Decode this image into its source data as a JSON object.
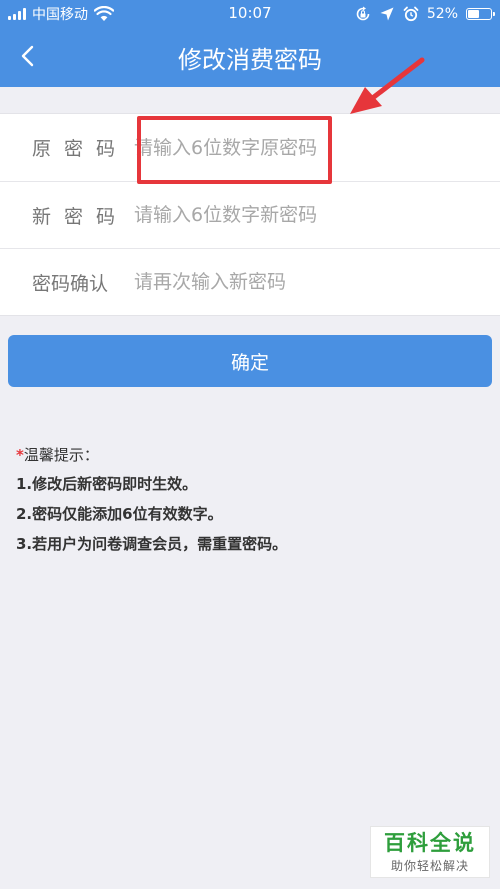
{
  "status_bar": {
    "carrier": "中国移动",
    "time": "10:07",
    "battery_percent": "52%",
    "battery_level": 0.52
  },
  "nav": {
    "back_icon": "chevron-left-icon",
    "title": "修改消费密码"
  },
  "form": {
    "old_password": {
      "label": "原密码",
      "placeholder": "请输入6位数字原密码",
      "value": ""
    },
    "new_password": {
      "label": "新密码",
      "placeholder": "请输入6位数字新密码",
      "value": ""
    },
    "confirm_password": {
      "label": "密码确认",
      "placeholder": "请再次输入新密码",
      "value": ""
    }
  },
  "confirm_button": {
    "label": "确定"
  },
  "tips": {
    "star": "*",
    "title": "温馨提示：",
    "items": [
      "1.修改后新密码即时生效。",
      "2.密码仅能添加6位有效数字。",
      "3.若用户为问卷调查会员，需重置密码。"
    ]
  },
  "watermark": {
    "main": "百科全说",
    "sub": "助你轻松解决"
  },
  "colors": {
    "primary": "#4a90e2",
    "background": "#efeff4",
    "annotation_red": "#e6363b",
    "watermark_green": "#2e9e3c"
  }
}
